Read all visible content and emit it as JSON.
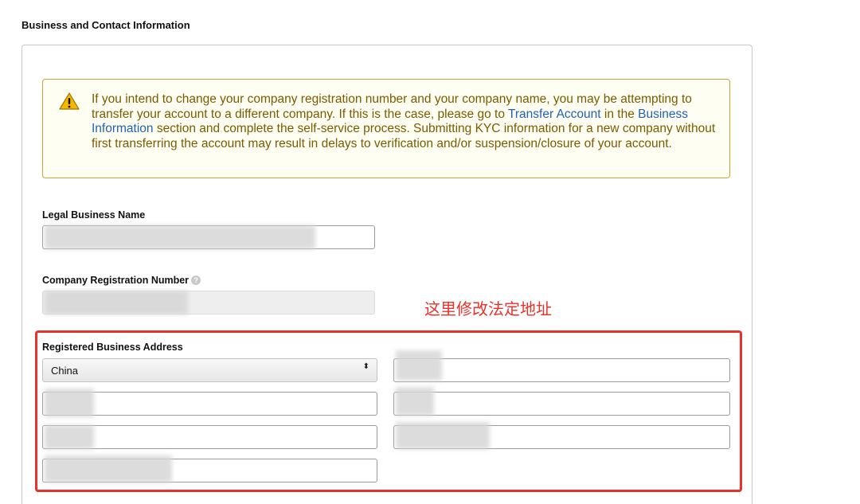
{
  "section": {
    "title": "Business and Contact Information"
  },
  "alert": {
    "icon": "warning-triangle-icon",
    "text_1": "If you intend to change your company registration number and your company name, you may be attempting to transfer your account to a different company. If this is the case, please go to ",
    "link_transfer": "Transfer Account",
    "text_2": " in the ",
    "link_business_info": "Business Information",
    "text_3": " section and complete the self-service process. Submitting KYC information for a new company without first transferring the account may result in delays to verification and/or suspension/closure of your account."
  },
  "fields": {
    "legal_business_name": {
      "label": "Legal Business Name",
      "value": ""
    },
    "company_registration_number": {
      "label": "Company Registration Number",
      "value": "",
      "help_icon": "question-mark-icon",
      "help_glyph": "?"
    },
    "registered_business_address": {
      "label": "Registered Business Address",
      "country": "China",
      "country_arrow": "⬍",
      "address_line_1": "",
      "address_line_2": "",
      "city": "",
      "state": "",
      "postal_code": "",
      "phone": ""
    }
  },
  "annotation": {
    "text": "这里修改法定地址",
    "color": "#e8322b"
  },
  "colors": {
    "alert_border": "#c8a53a",
    "alert_text": "#7a5b00",
    "link": "#1f63b2"
  }
}
